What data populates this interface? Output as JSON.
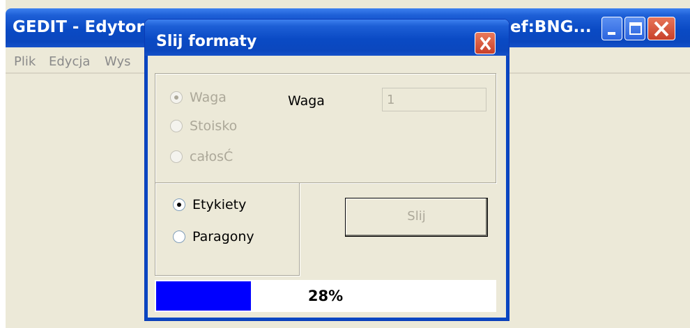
{
  "main_window": {
    "title": "GEDIT - Edytor",
    "title_right": "ef:BNG...",
    "menu": [
      "Plik",
      "Edycja",
      "Wys"
    ]
  },
  "dialog": {
    "title": "Slij formaty",
    "source_group": {
      "radios": [
        {
          "label": "Waga",
          "checked": true,
          "enabled": false
        },
        {
          "label": "Stoisko",
          "checked": false,
          "enabled": false
        },
        {
          "label": "całosĆ",
          "checked": false,
          "enabled": false
        }
      ],
      "waga_label": "Waga",
      "waga_value": "1"
    },
    "type_group": {
      "radios": [
        {
          "label": "Etykiety",
          "checked": true,
          "enabled": true
        },
        {
          "label": "Paragony",
          "checked": false,
          "enabled": true
        }
      ]
    },
    "send_button_label": "Slij",
    "progress": {
      "percent": 28,
      "label": "28%",
      "fill_color": "#0000ff"
    }
  },
  "colors": {
    "titlebar": "#0a4ac4",
    "face": "#ece9d8",
    "close_button": "#c8402a"
  }
}
